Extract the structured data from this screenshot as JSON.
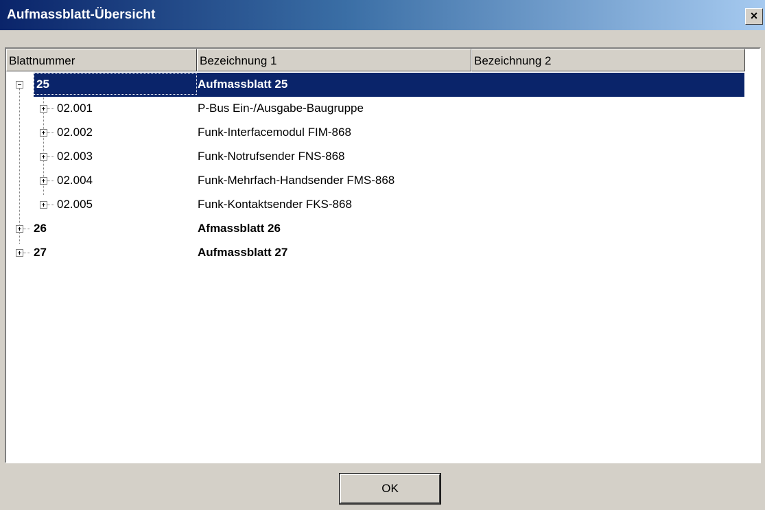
{
  "window": {
    "title": "Aufmassblatt-Übersicht",
    "close_label": "×"
  },
  "columns": [
    "Blattnummer",
    "Bezeichnung 1",
    "Bezeichnung 2"
  ],
  "tree": [
    {
      "number": "25",
      "desc1": "Aufmassblatt 25",
      "desc2": "",
      "expanded": true,
      "selected": true,
      "children": [
        {
          "number": "02.001",
          "desc1": "P-Bus Ein-/Ausgabe-Baugruppe",
          "desc2": ""
        },
        {
          "number": "02.002",
          "desc1": "Funk-Interfacemodul FIM-868",
          "desc2": ""
        },
        {
          "number": "02.003",
          "desc1": "Funk-Notrufsender FNS-868",
          "desc2": ""
        },
        {
          "number": "02.004",
          "desc1": "Funk-Mehrfach-Handsender FMS-868",
          "desc2": ""
        },
        {
          "number": "02.005",
          "desc1": "Funk-Kontaktsender FKS-868",
          "desc2": ""
        }
      ]
    },
    {
      "number": "26",
      "desc1": "Afmassblatt 26",
      "desc2": "",
      "expanded": false
    },
    {
      "number": "27",
      "desc1": "Aufmassblatt 27",
      "desc2": "",
      "expanded": false
    }
  ],
  "buttons": {
    "ok": "OK"
  }
}
